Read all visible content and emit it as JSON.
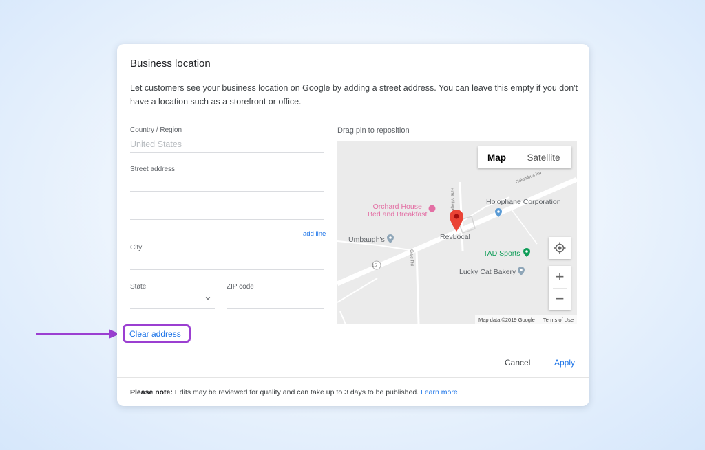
{
  "dialog": {
    "title": "Business location",
    "description": "Let customers see your business location on Google by adding a street address. You can leave this empty if you don't have a location such as a storefront or office."
  },
  "form": {
    "country_label": "Country / Region",
    "country_value": "United States",
    "street_label": "Street address",
    "add_line": "add line",
    "city_label": "City",
    "state_label": "State",
    "zip_label": "ZIP code",
    "clear_address": "Clear address"
  },
  "map": {
    "drag_label": "Drag pin to reposition",
    "toggle_map": "Map",
    "toggle_satellite": "Satellite",
    "zoom_in": "+",
    "zoom_out": "−",
    "pois": {
      "orchard_house_1": "Orchard House",
      "orchard_house_2": "Bed and Breakfast",
      "holophane": "Holophane Corporation",
      "umbaughs": "Umbaugh's",
      "revlocal": "RevLocal",
      "tad_sports": "TAD Sports",
      "lucky_cat": "Lucky Cat Bakery"
    },
    "roads": {
      "columbus": "Columbus Rd",
      "gale": "Gale Rd",
      "village": "Pine Village Dr",
      "route": "15"
    },
    "attribution": "Map data ©2019 Google",
    "terms": "Terms of Use",
    "colors": {
      "pin": "#ea4335",
      "poi_green": "#0f9d58",
      "poi_pink": "#e36fa4",
      "poi_blue": "#5b9bd5"
    }
  },
  "actions": {
    "cancel": "Cancel",
    "apply": "Apply"
  },
  "footer": {
    "note_bold": "Please note:",
    "note_text": " Edits may be reviewed for quality and can take up to 3 days to be published. ",
    "learn_more": "Learn more"
  },
  "colors": {
    "accent": "#1a73e8",
    "highlight": "#9b3fd1"
  }
}
